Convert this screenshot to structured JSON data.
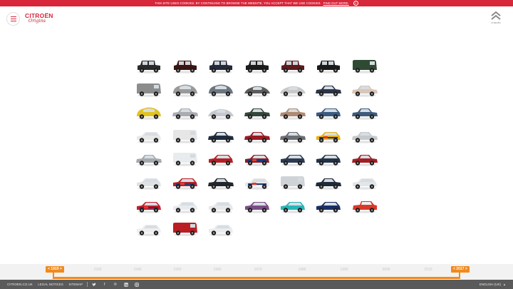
{
  "cookie_banner": {
    "text": "THIS SITE USES COOKIES. BY CONTINUING TO BROWSE THE WEBSITE, YOU ACCEPT THAT WE USE COOKIES.",
    "link": "FIND OUT MORE.",
    "close_icon": "close-circle-icon"
  },
  "header": {
    "menu_icon": "hamburger-icon",
    "brand": "CITROËN",
    "brand_sub": "Origins",
    "corp_word": "CITROËN"
  },
  "timeline": {
    "start_label": "< 1919 >",
    "end_label": "< 2017 >",
    "decades": [
      "1930",
      "1940",
      "1950",
      "1960",
      "1970",
      "1980",
      "1990",
      "2000",
      "2010"
    ],
    "accent": "#f08a1c"
  },
  "footer": {
    "site_link": "CITROEN.CO.UK",
    "legal_link": "LEGAL NOTICES",
    "sitemap_link": "SITEMAP",
    "social_icons": [
      "twitter-icon",
      "facebook-icon",
      "pinterest-icon",
      "linkedin-icon",
      "instagram-icon"
    ],
    "language": "ENGLISH (UK)"
  },
  "colors": {
    "brand_red": "#d8263a",
    "footer_bg": "#5a5a5a"
  },
  "cars": [
    {
      "c": "#2a2a2a",
      "s": "vintage"
    },
    {
      "c": "#3a1512",
      "s": "vintage"
    },
    {
      "c": "#252a3a",
      "s": "vintage"
    },
    {
      "c": "#1c1c1c",
      "s": "vintage"
    },
    {
      "c": "#5c1a1d",
      "s": "vintage"
    },
    {
      "c": "#1a1a1a",
      "s": "vintage"
    },
    {
      "c": "#2f4a32",
      "s": "van"
    },
    {
      "c": "#8c8c8c",
      "s": "van"
    },
    {
      "c": "#9a9a9a",
      "s": "round"
    },
    {
      "c": "#6d7580",
      "s": "round"
    },
    {
      "c": "#5c5c5c",
      "s": "sleek"
    },
    {
      "c": "#c9c9c9",
      "s": "sleek"
    },
    {
      "c": "#2b3448",
      "s": "sedan"
    },
    {
      "c": "#d8c6b8",
      "s": "sedan"
    },
    {
      "c": "#e2c21f",
      "s": "round"
    },
    {
      "c": "#a9acb0",
      "s": "sedan"
    },
    {
      "c": "#c5c8cc",
      "s": "sleek"
    },
    {
      "c": "#32463a",
      "s": "sedan"
    },
    {
      "c": "#b08a72",
      "s": "sedan"
    },
    {
      "c": "#3b5a80",
      "s": "hatch"
    },
    {
      "c": "#3d5c7c",
      "s": "sedan"
    },
    {
      "c": "#e8e8e8",
      "s": "hatch"
    },
    {
      "c": "#e6e6e6",
      "s": "van"
    },
    {
      "c": "#1e2c3e",
      "s": "sedan"
    },
    {
      "c": "#9c1b22",
      "s": "sedan"
    },
    {
      "c": "#6a6e74",
      "s": "sedan"
    },
    {
      "c": "#e9b213",
      "s": "rally"
    },
    {
      "c": "#c6c9cc",
      "s": "sedan"
    },
    {
      "c": "#a5a9ae",
      "s": "sedan"
    },
    {
      "c": "#e9ecee",
      "s": "van"
    },
    {
      "c": "#b41f26",
      "s": "hatch"
    },
    {
      "c": "#8a1b26",
      "s": "rally"
    },
    {
      "c": "#2c3b52",
      "s": "hatch"
    },
    {
      "c": "#243246",
      "s": "hatch"
    },
    {
      "c": "#a21e24",
      "s": "sedan"
    },
    {
      "c": "#dfe2e5",
      "s": "hatch"
    },
    {
      "c": "#b52027",
      "s": "rally"
    },
    {
      "c": "#23272d",
      "s": "sedan"
    },
    {
      "c": "#e5e8ea",
      "s": "rally"
    },
    {
      "c": "#cfd3d8",
      "s": "van"
    },
    {
      "c": "#1f2a3b",
      "s": "sedan"
    },
    {
      "c": "#e3e6e9",
      "s": "hatch"
    },
    {
      "c": "#c71d2b",
      "s": "rally"
    },
    {
      "c": "#e8ebee",
      "s": "hatch"
    },
    {
      "c": "#e6e8eb",
      "s": "hatch"
    },
    {
      "c": "#7b4c86",
      "s": "hatch"
    },
    {
      "c": "#28b5b7",
      "s": "hatch"
    },
    {
      "c": "#1b2e66",
      "s": "hatch"
    },
    {
      "c": "#d93a27",
      "s": "buggy"
    },
    {
      "c": "#eeeeee",
      "s": "hatch"
    },
    {
      "c": "#b81e24",
      "s": "van"
    },
    {
      "c": "#ececec",
      "s": "hatch"
    }
  ]
}
